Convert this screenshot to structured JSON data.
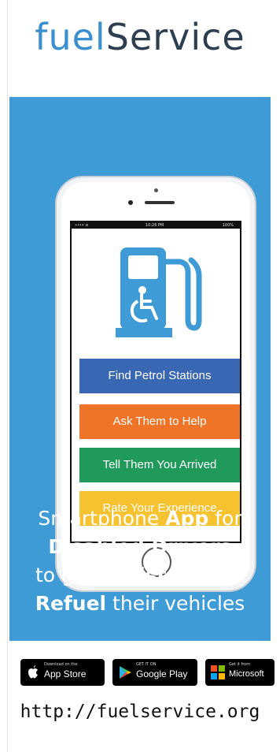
{
  "logo": {
    "part1": "fuel",
    "part2": "Service"
  },
  "phone": {
    "status": {
      "signal": "•••• ≋",
      "time": "10:26 PM",
      "battery": "100%"
    },
    "buttons": [
      {
        "label": "Find Petrol Stations",
        "color": "#3a67b4"
      },
      {
        "label": "Ask Them to Help",
        "color": "#f07427"
      },
      {
        "label": "Tell Them You Arrived",
        "color": "#1f9a5a"
      },
      {
        "label": "Rate Your Experience",
        "color": "#f6c230"
      }
    ]
  },
  "tagline": {
    "l1a": "Smartphone ",
    "l1b": "App",
    "l1c": " for",
    "l2": "Disabled Drivers",
    "l3a": "to get ",
    "l3b": "Assistance",
    "l3c": " to",
    "l4a": "Refuel",
    "l4b": " their vehicles"
  },
  "stores": {
    "apple": {
      "small": "Download on the",
      "big": "App Store",
      "icon": "apple-icon"
    },
    "google": {
      "small": "GET IT ON",
      "big": "Google Play",
      "icon": "google-play-icon"
    },
    "microsoft": {
      "small": "Get it from",
      "big": "Microsoft",
      "icon": "microsoft-icon"
    }
  },
  "url": "http://fuelservice.org",
  "colors": {
    "panel": "#3f9bd6",
    "logo_fuel": "#3a8fd0",
    "logo_service": "#2c3e50"
  }
}
